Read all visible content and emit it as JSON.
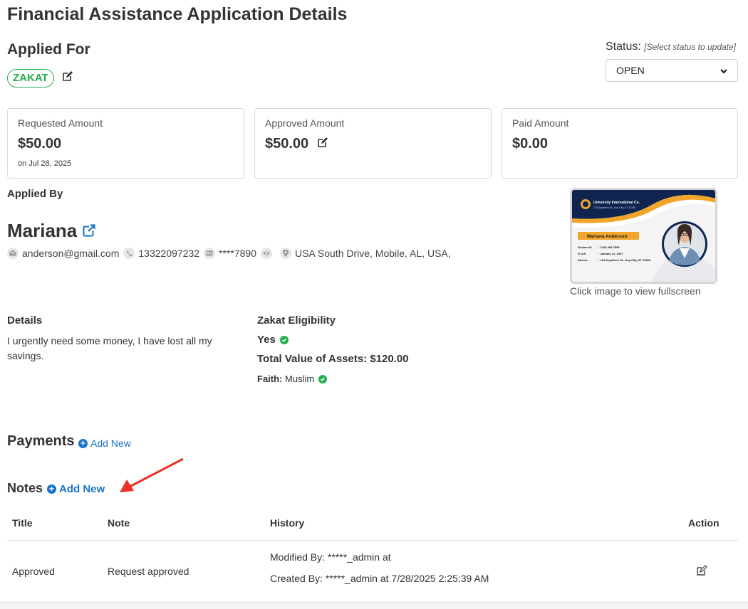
{
  "page": {
    "title": "Financial Assistance Application Details"
  },
  "applied_for": {
    "title": "Applied For",
    "badge": "ZAKAT",
    "edit_icon": "edit-icon",
    "badge_color": "#22b14c"
  },
  "status": {
    "label": "Status:",
    "hint": "[Select status to update]",
    "selected": "OPEN"
  },
  "amounts": {
    "requested": {
      "label": "Requested Amount",
      "value": "$50.00",
      "date": "on Jul 28, 2025"
    },
    "approved": {
      "label": "Approved Amount",
      "value": "$50.00"
    },
    "paid": {
      "label": "Paid Amount",
      "value": "$0.00"
    }
  },
  "applicant": {
    "section_title": "Applied By",
    "name": "Mariana",
    "email": "anderson@gmail.com",
    "phone": "13322097232",
    "id_masked": "****7890",
    "address": "USA South Drive, Mobile, AL, USA,"
  },
  "id_card": {
    "org_name": "University International Co.",
    "org_address": "123 Anywhere St., Any City, ST 12345",
    "holder_name": "Mariana Anderson",
    "student_id_label": "Student Id",
    "student_id": ": 1234-456-7890",
    "dob_label": "D.O.B",
    "dob": ": January 12, 2007",
    "address_label": "Adress",
    "address": ": 123 Anywhere St., Any City, ST 12345",
    "caption": "Click image to view fullscreen"
  },
  "details": {
    "title": "Details",
    "text": "I urgently need some money, I have lost all my savings."
  },
  "zakat": {
    "title": "Zakat Eligibility",
    "eligible": "Yes",
    "assets": "Total Value of Assets: $120.00",
    "faith_label": "Faith:",
    "faith_value": "Muslim"
  },
  "payments": {
    "title": "Payments",
    "add_label": "Add New"
  },
  "notes": {
    "title": "Notes",
    "add_label": "Add New",
    "columns": [
      "Title",
      "Note",
      "History",
      "Action"
    ],
    "rows": [
      {
        "title": "Approved",
        "note": "Request approved",
        "modified": "Modified By: *****_admin at",
        "created": "Created By: *****_admin at 7/28/2025 2:25:39 AM"
      }
    ]
  },
  "colors": {
    "accent": "#1a73c8",
    "success": "#22b14c",
    "annotation_arrow": "#e8302a"
  }
}
